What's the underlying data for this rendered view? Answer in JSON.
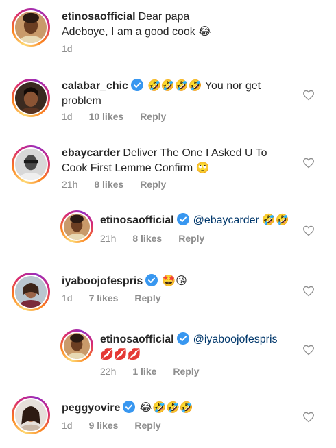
{
  "comments": [
    {
      "username": "etinosaofficial",
      "verified": false,
      "text": "Dear papa Adeboye, I am a good cook 😂",
      "time": "1d",
      "likes": "",
      "reply": ""
    },
    {
      "username": "calabar_chic",
      "verified": true,
      "emoji_prefix": "🤣🤣🤣🤣",
      "text": "You nor get problem",
      "time": "1d",
      "likes": "10 likes",
      "reply": "Reply"
    },
    {
      "username": "ebaycarder",
      "verified": false,
      "text": "Deliver The One I Asked U To Cook First Lemme Confirm 🙄",
      "time": "21h",
      "likes": "8 likes",
      "reply": "Reply"
    },
    {
      "username": "etinosaofficial",
      "verified": true,
      "mention": "@ebaycarder",
      "text": "🤣🤣",
      "time": "21h",
      "likes": "8 likes",
      "reply": "Reply"
    },
    {
      "username": "iyaboojofespris",
      "verified": true,
      "text": "🤩😘",
      "time": "1d",
      "likes": "7 likes",
      "reply": "Reply"
    },
    {
      "username": "etinosaofficial",
      "verified": true,
      "mention": "@iyaboojofespris",
      "text": "💋💋💋",
      "time": "22h",
      "likes": "1 like",
      "reply": "Reply"
    },
    {
      "username": "peggyovire",
      "verified": true,
      "text": "😂🤣🤣🤣",
      "time": "1d",
      "likes": "9 likes",
      "reply": "Reply"
    }
  ],
  "icons": {
    "verified": "verified-badge-icon",
    "like": "heart-outline-icon"
  },
  "colors": {
    "username": "#262626",
    "mention": "#00376b",
    "meta": "#8e8e8e",
    "verified": "#3897f0"
  }
}
